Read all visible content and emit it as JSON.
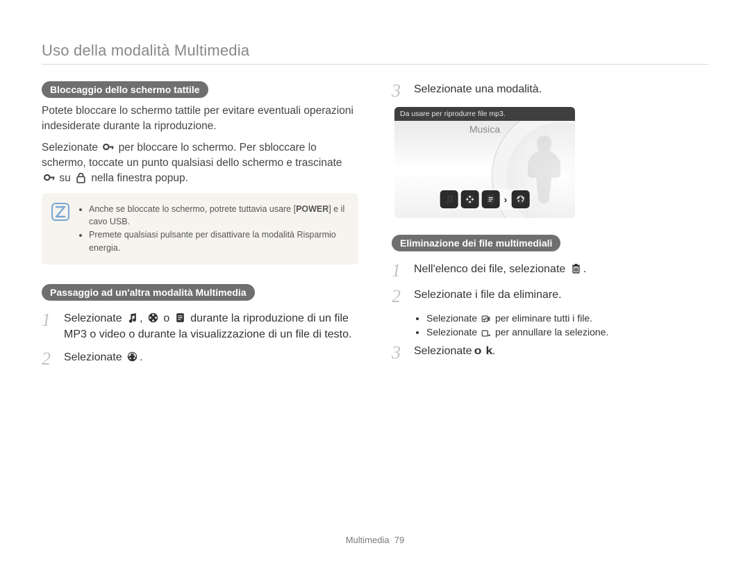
{
  "page_header": "Uso della modalità Multimedia",
  "left": {
    "heading1": "Bloccaggio dello schermo tattile",
    "p1": "Potete bloccare lo schermo tattile per evitare eventuali operazioni indesiderate durante la riproduzione.",
    "p2a": "Selezionate ",
    "p2b": " per bloccare lo schermo. Per sbloccare lo schermo, toccate un punto qualsiasi dello schermo e trascinate ",
    "p2c": " su ",
    "p2d": " nella finestra popup.",
    "note1a": "Anche se bloccate lo schermo, potrete tuttavia usare [",
    "note1_power": "POWER",
    "note1b": "] e il cavo USB.",
    "note2": "Premete qualsiasi pulsante per disattivare la modalità Risparmio energia.",
    "heading2": "Passaggio ad un'altra modalità Multimedia",
    "step1a": "Selezionate ",
    "step1b": ", ",
    "step1c": " o ",
    "step1d": " durante la riproduzione di un file MP3 o video o durante la visualizzazione di un file di testo.",
    "step2a": "Selezionate ",
    "step2b": "."
  },
  "right": {
    "top_step_num": "3",
    "top_step_text": "Selezionate una modalità.",
    "device_tip": "Da usare per riprodurre file mp3.",
    "device_title": "Musica",
    "heading3": "Eliminazione dei file multimediali",
    "d_step1a": "Nell'elenco dei file, selezionate ",
    "d_step1b": ".",
    "d_step2": "Selezionate i file da eliminare.",
    "d_sub1a": "Selezionate ",
    "d_sub1b": " per eliminare tutti i file.",
    "d_sub2a": "Selezionate ",
    "d_sub2b": " per annullare la selezione.",
    "d_step3a": "Selezionate ",
    "d_step3_ok": "o k",
    "d_step3b": "."
  },
  "footer_section": "Multimedia",
  "footer_page": "79"
}
